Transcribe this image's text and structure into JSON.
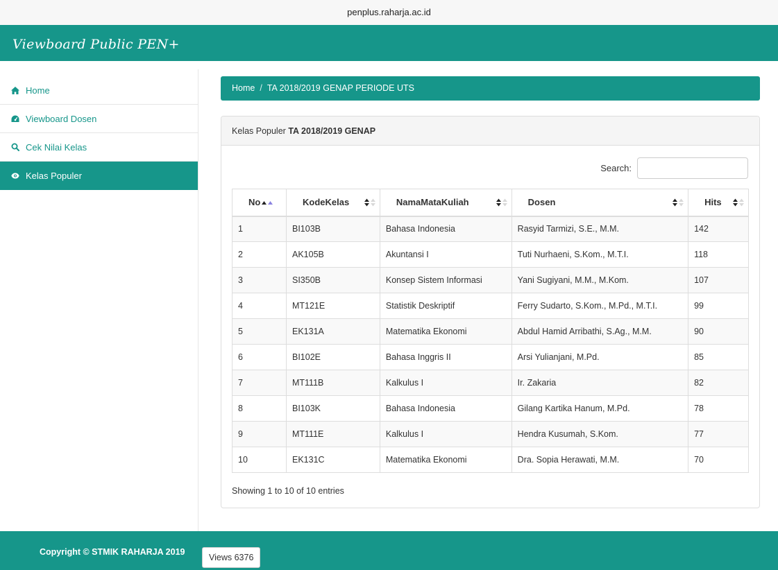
{
  "browser": {
    "url": "penplus.raharja.ac.id"
  },
  "header": {
    "brand": "Viewboard Public PEN+"
  },
  "sidebar": {
    "items": [
      {
        "label": "Home",
        "icon": "home-icon",
        "active": false
      },
      {
        "label": "Viewboard Dosen",
        "icon": "dashboard-icon",
        "active": false
      },
      {
        "label": "Cek Nilai Kelas",
        "icon": "search-icon",
        "active": false
      },
      {
        "label": "Kelas Populer",
        "icon": "eye-icon",
        "active": true
      }
    ]
  },
  "breadcrumb": {
    "home": "Home",
    "separator": "/",
    "current": "TA 2018/2019 GENAP PERIODE UTS"
  },
  "panel": {
    "title_prefix": "Kelas Populer",
    "title_bold": "TA 2018/2019 GENAP"
  },
  "search": {
    "label": "Search:",
    "value": ""
  },
  "table": {
    "columns": [
      "No",
      "KodeKelas",
      "NamaMataKuliah",
      "Dosen",
      "Hits"
    ],
    "sorted_column": "No",
    "rows": [
      [
        "1",
        "BI103B",
        "Bahasa Indonesia",
        "Rasyid Tarmizi, S.E., M.M.",
        "142"
      ],
      [
        "2",
        "AK105B",
        "Akuntansi I",
        "Tuti Nurhaeni, S.Kom., M.T.I.",
        "118"
      ],
      [
        "3",
        "SI350B",
        "Konsep Sistem Informasi",
        "Yani Sugiyani, M.M., M.Kom.",
        "107"
      ],
      [
        "4",
        "MT121E",
        "Statistik Deskriptif",
        "Ferry Sudarto, S.Kom., M.Pd., M.T.I.",
        "99"
      ],
      [
        "5",
        "EK131A",
        "Matematika Ekonomi",
        "Abdul Hamid Arribathi, S.Ag., M.M.",
        "90"
      ],
      [
        "6",
        "BI102E",
        "Bahasa Inggris II",
        "Arsi Yulianjani, M.Pd.",
        "85"
      ],
      [
        "7",
        "MT111B",
        "Kalkulus I",
        "Ir. Zakaria",
        "82"
      ],
      [
        "8",
        "BI103K",
        "Bahasa Indonesia",
        "Gilang Kartika Hanum, M.Pd.",
        "78"
      ],
      [
        "9",
        "MT111E",
        "Kalkulus I",
        "Hendra Kusumah, S.Kom.",
        "77"
      ],
      [
        "10",
        "EK131C",
        "Matematika Ekonomi",
        "Dra. Sopia Herawati, M.M.",
        "70"
      ]
    ],
    "info": "Showing 1 to 10 of 10 entries"
  },
  "footer": {
    "copyright": "Copyright © STMIK RAHARJA 2019",
    "views_label": "Views 6376"
  },
  "colors": {
    "accent": "#16968a",
    "sort_active": "#8a82e0"
  }
}
